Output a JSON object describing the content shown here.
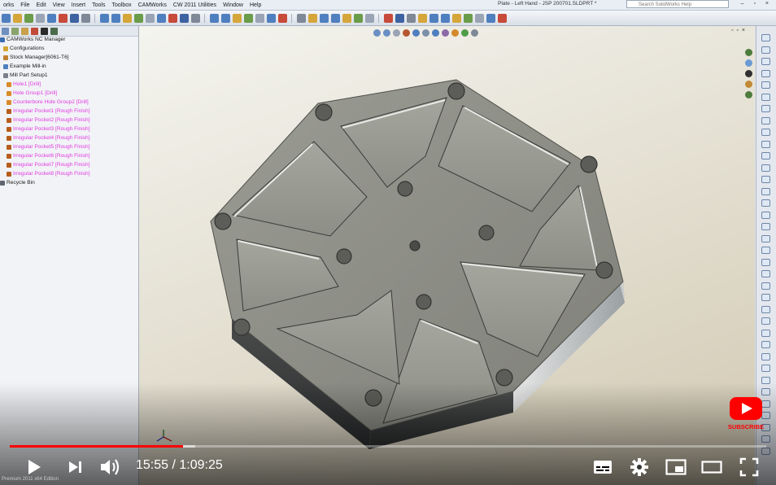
{
  "menu": {
    "items": [
      "orks",
      "File",
      "Edit",
      "View",
      "Insert",
      "Tools",
      "Toolbox",
      "CAMWorks",
      "CW 2011 Utilities",
      "Window",
      "Help"
    ],
    "document_title": "Plate - Left Hand - JSP 200701.SLDPRT *",
    "search_placeholder": "Search SolidWorks Help",
    "window_controls": "– ▫ ×"
  },
  "tree": {
    "nodes": [
      {
        "label": "CAMWorks NC Manager",
        "indent": 0,
        "color": "normal",
        "icon": "nc-manager-icon"
      },
      {
        "label": "Configurations",
        "indent": 1,
        "color": "normal",
        "icon": "configurations-icon"
      },
      {
        "label": "Stock Manager[6061-T6]",
        "indent": 1,
        "color": "normal",
        "icon": "stock-icon"
      },
      {
        "label": "Example Mill-in",
        "indent": 1,
        "color": "normal",
        "icon": "machine-icon"
      },
      {
        "label": "Mill Part Setup1",
        "indent": 1,
        "color": "normal",
        "icon": "setup-icon"
      },
      {
        "label": "Hole1 [Drill]",
        "indent": 2,
        "color": "pink",
        "icon": "hole-feature-icon"
      },
      {
        "label": "Hole Group1 [Drill]",
        "indent": 2,
        "color": "pink",
        "icon": "hole-feature-icon"
      },
      {
        "label": "Counterbore Hole Group2 [Drill]",
        "indent": 2,
        "color": "pink",
        "icon": "hole-feature-icon"
      },
      {
        "label": "Irregular Pocket1 [Rough Finish]",
        "indent": 2,
        "color": "pink",
        "icon": "pocket-feature-icon"
      },
      {
        "label": "Irregular Pocket2 [Rough Finish]",
        "indent": 2,
        "color": "pink",
        "icon": "pocket-feature-icon"
      },
      {
        "label": "Irregular Pocket3 [Rough Finish]",
        "indent": 2,
        "color": "pink",
        "icon": "pocket-feature-icon"
      },
      {
        "label": "Irregular Pocket4 [Rough Finish]",
        "indent": 2,
        "color": "pink",
        "icon": "pocket-feature-icon"
      },
      {
        "label": "Irregular Pocket5 [Rough Finish]",
        "indent": 2,
        "color": "pink",
        "icon": "pocket-feature-icon"
      },
      {
        "label": "Irregular Pocket6 [Rough Finish]",
        "indent": 2,
        "color": "pink",
        "icon": "pocket-feature-icon"
      },
      {
        "label": "Irregular Pocket7 [Rough Finish]",
        "indent": 2,
        "color": "pink",
        "icon": "pocket-feature-icon"
      },
      {
        "label": "Irregular Pocket8 [Rough Finish]",
        "indent": 2,
        "color": "pink",
        "icon": "pocket-feature-icon"
      },
      {
        "label": "Recycle Bin",
        "indent": 0,
        "color": "normal",
        "icon": "recycle-bin-icon"
      }
    ]
  },
  "colors": {
    "pink_feature": "#e23be2",
    "youtube_red": "#ff0000",
    "part_face": "#8e8f86",
    "part_side": "#3b3d3d"
  },
  "player": {
    "current_time": "15:55",
    "duration": "1:09:25",
    "played_fraction": 0.229,
    "buffered_fraction": 0.245,
    "subscribe_label": "SUBSCRIBE",
    "controls": [
      "play-icon",
      "next-icon",
      "volume-icon",
      "subtitles-icon",
      "settings-icon",
      "miniplayer-icon",
      "theater-icon",
      "fullscreen-icon"
    ]
  },
  "status_bar": "Premium 2011 x64 Edition"
}
